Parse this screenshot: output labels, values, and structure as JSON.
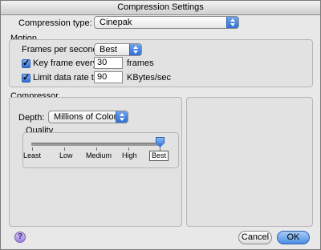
{
  "window": {
    "title": "Compression Settings"
  },
  "compression": {
    "label": "Compression type:",
    "value": "Cinepak"
  },
  "motion": {
    "title": "Motion",
    "fps_label": "Frames per second:",
    "fps_value": "Best",
    "keyframe_label": "Key frame every",
    "keyframe_value": "30",
    "keyframe_unit": "frames",
    "keyframe_checked": true,
    "datarate_label": "Limit data rate to",
    "datarate_value": "90",
    "datarate_unit": "KBytes/sec",
    "datarate_checked": true
  },
  "compressor": {
    "title": "Compressor",
    "depth_label": "Depth:",
    "depth_value": "Millions of Colors",
    "quality": {
      "title": "Quality",
      "ticks": [
        "Least",
        "Low",
        "Medium",
        "High",
        "Best"
      ],
      "selected": "Best",
      "level_fraction": 1.0
    }
  },
  "buttons": {
    "cancel": "Cancel",
    "ok": "OK",
    "help": "?"
  },
  "colors": {
    "accent": "#2f6fd6",
    "window_bg": "#e8e8e8"
  }
}
